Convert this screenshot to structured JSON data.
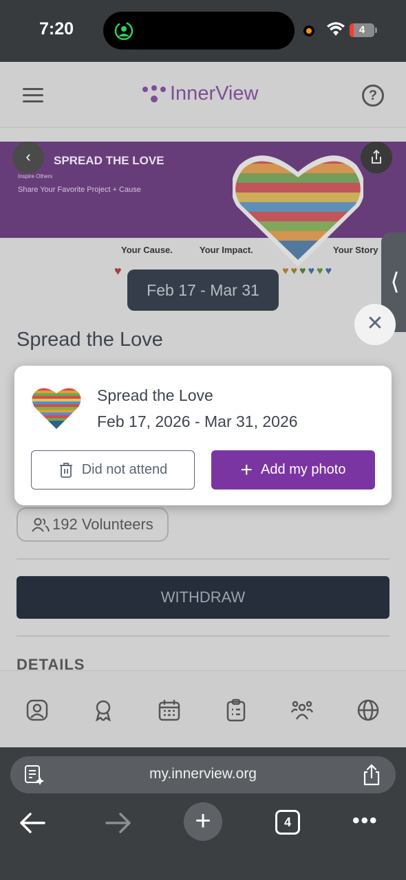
{
  "status_bar": {
    "time": "7:20",
    "battery": "4"
  },
  "app": {
    "brand": "InnerView",
    "accent": "#7b35a3"
  },
  "banner": {
    "title": "SPREAD THE LOVE",
    "subtitle_1": "Inspire Others",
    "subtitle_2": "Share Your Favorite Project + Cause",
    "tagline_1": "Your Cause.",
    "tagline_2": "Your Impact.",
    "tagline_3": "Your Story"
  },
  "event": {
    "date_pill": "Feb 17 - Mar 31",
    "title": "Spread the Love",
    "volunteers": "192 Volunteers",
    "withdraw_label": "WITHDRAW",
    "details_heading": "DETAILS"
  },
  "dialog": {
    "title": "Spread the Love",
    "dates": "Feb 17, 2026 - Mar 31, 2026",
    "did_not_attend_label": "Did not attend",
    "add_photo_label": "Add my photo"
  },
  "bottom_nav": {
    "icons": [
      "profile-icon",
      "award-icon",
      "calendar-icon",
      "clipboard-icon",
      "groups-icon",
      "globe-icon"
    ]
  },
  "browser": {
    "url": "my.innerview.org",
    "tab_count": "4"
  }
}
